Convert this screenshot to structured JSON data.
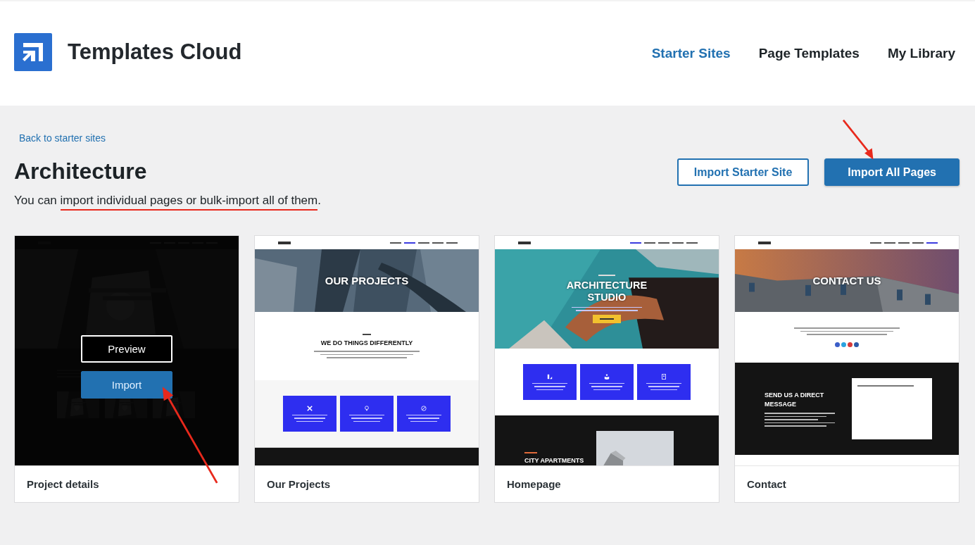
{
  "header": {
    "brand": "Templates Cloud",
    "nav": [
      {
        "label": "Starter Sites",
        "selected": true
      },
      {
        "label": "Page Templates",
        "selected": false
      },
      {
        "label": "My Library",
        "selected": false
      }
    ]
  },
  "back_link": "Back to starter sites",
  "title": "Architecture",
  "description": [
    {
      "text": "You can ",
      "marked": false
    },
    {
      "text": "import individual pages or bulk-import all of them",
      "marked": true
    },
    {
      "text": ".",
      "marked": false
    }
  ],
  "buttons": [
    {
      "label": "Import Starter Site",
      "kind": "outline"
    },
    {
      "label": "Import All Pages",
      "kind": "primary"
    }
  ],
  "card_actions": {
    "preview": "Preview",
    "import": "Import"
  },
  "cards": [
    {
      "title": "Project details",
      "hovered": true,
      "thumbnail": {
        "sections": [
          {
            "kind": "dim_hero"
          },
          {
            "kind": "gallery"
          }
        ]
      }
    },
    {
      "title": "Our Projects",
      "hovered": false,
      "thumbnail": {
        "sections": [
          {
            "kind": "hero",
            "title": "OUR PROJECTS"
          },
          {
            "kind": "intro",
            "title": "WE DO THINGS DIFFERENTLY"
          },
          {
            "kind": "features"
          },
          {
            "kind": "dark"
          }
        ]
      }
    },
    {
      "title": "Homepage",
      "hovered": false,
      "thumbnail": {
        "sections": [
          {
            "kind": "welcome",
            "title": "ARCHITECTURE STUDIO"
          },
          {
            "kind": "services"
          },
          {
            "kind": "project",
            "title": "CITY APARTMENTS"
          }
        ]
      }
    },
    {
      "title": "Contact",
      "hovered": false,
      "thumbnail": {
        "sections": [
          {
            "kind": "hero",
            "title": "CONTACT US"
          },
          {
            "kind": "contact",
            "socials": [
              {
                "color": "#3b5ec8"
              },
              {
                "color": "#2aa3e0"
              },
              {
                "color": "#d63a3a"
              },
              {
                "color": "#2d5aa8"
              }
            ]
          },
          {
            "kind": "message",
            "title": "SEND US A DIRECT MESSAGE"
          },
          {
            "kind": "blank"
          }
        ]
      }
    }
  ]
}
